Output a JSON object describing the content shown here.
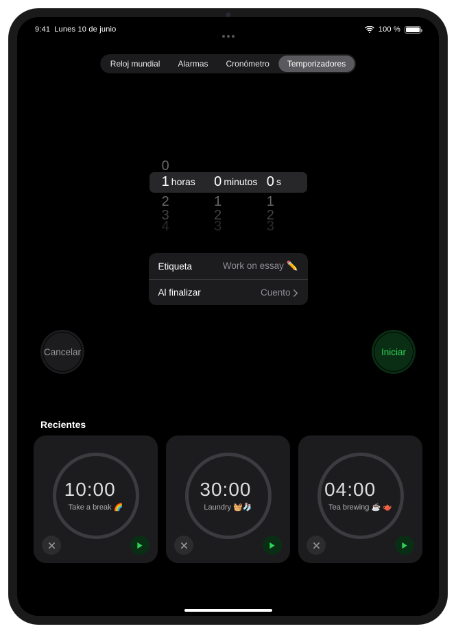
{
  "status": {
    "time": "9:41",
    "date": "Lunes 10 de junio",
    "battery_pct": "100 %"
  },
  "tabs": {
    "world": "Reloj mundial",
    "alarms": "Alarmas",
    "stopwatch": "Cronómetro",
    "timers": "Temporizadores"
  },
  "picker": {
    "hours": {
      "above1": "0",
      "selected": "1",
      "below1": "2",
      "below2": "3",
      "below3": "4",
      "unit": "horas"
    },
    "minutes": {
      "selected": "0",
      "below1": "1",
      "below2": "2",
      "below3": "3",
      "unit": "minutos"
    },
    "seconds": {
      "selected": "0",
      "below1": "1",
      "below2": "2",
      "below3": "3",
      "unit": "s"
    }
  },
  "settings": {
    "label_label": "Etiqueta",
    "label_value": "Work on essay ✏️",
    "end_label": "Al finalizar",
    "end_value": "Cuento"
  },
  "buttons": {
    "cancel": "Cancelar",
    "start": "Iniciar"
  },
  "recents": {
    "title": "Recientes",
    "items": [
      {
        "time": "10:00",
        "caption": "Take a break 🌈"
      },
      {
        "time": "30:00",
        "caption": "Laundry 🧺🧦"
      },
      {
        "time": "04:00",
        "caption": "Tea brewing ☕️ 🫖"
      }
    ]
  }
}
